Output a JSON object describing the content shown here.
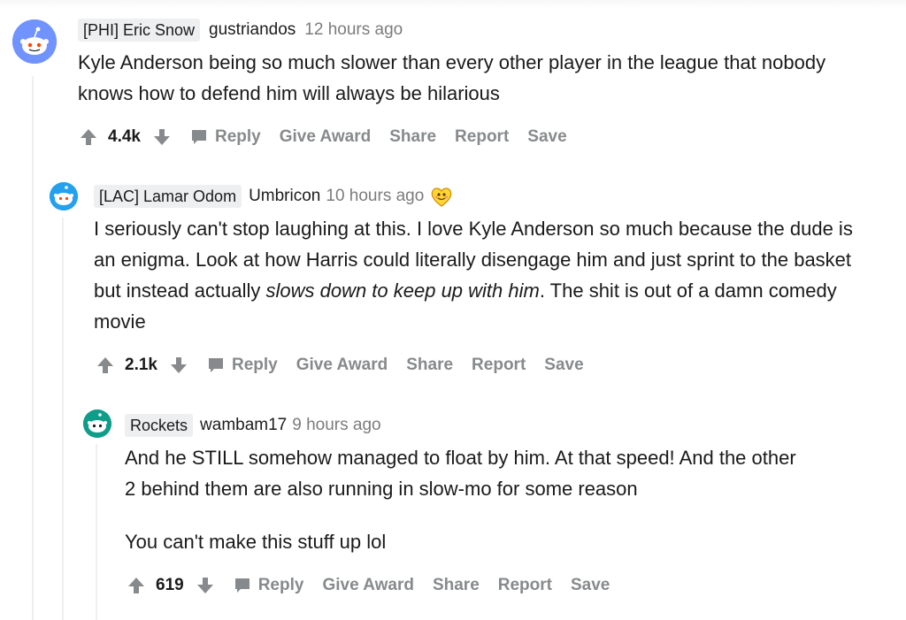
{
  "comments": [
    {
      "flair": "[PHI] Eric Snow",
      "author": "gustriandos",
      "time": "12 hours ago",
      "body": "Kyle Anderson being so much slower than every other player in the league that nobody knows how to defend him will always be hilarious",
      "score": "4.4k",
      "avatar_color": "#7193ff",
      "avatar_icon": "snoo-icon"
    },
    {
      "flair": "[LAC] Lamar Odom",
      "author": "Umbricon",
      "time": "10 hours ago",
      "award_icon": "wholesome-award-icon",
      "body_parts": [
        "I seriously can't stop laughing at this. I love Kyle Anderson so much because the dude is an enigma. Look at how Harris could literally disengage him and just sprint to the basket but instead actually ",
        "slows down to keep up with him",
        ". The shit is out of a damn comedy movie"
      ],
      "score": "2.1k",
      "avatar_color": "#24a0ed",
      "avatar_icon": "snoo-icon"
    },
    {
      "flair": "Rockets",
      "author": "wambam17",
      "time": "9 hours ago",
      "body": "And he STILL somehow managed to float by him. At that speed! And the other 2 behind them are also running in slow-mo for some reason",
      "body2": "You can't make this stuff up lol",
      "score": "619",
      "avatar_color": "#0f9d8a",
      "avatar_icon": "snoo-icon"
    }
  ],
  "actions": {
    "reply": "Reply",
    "give_award": "Give Award",
    "share": "Share",
    "report": "Report",
    "save": "Save"
  }
}
